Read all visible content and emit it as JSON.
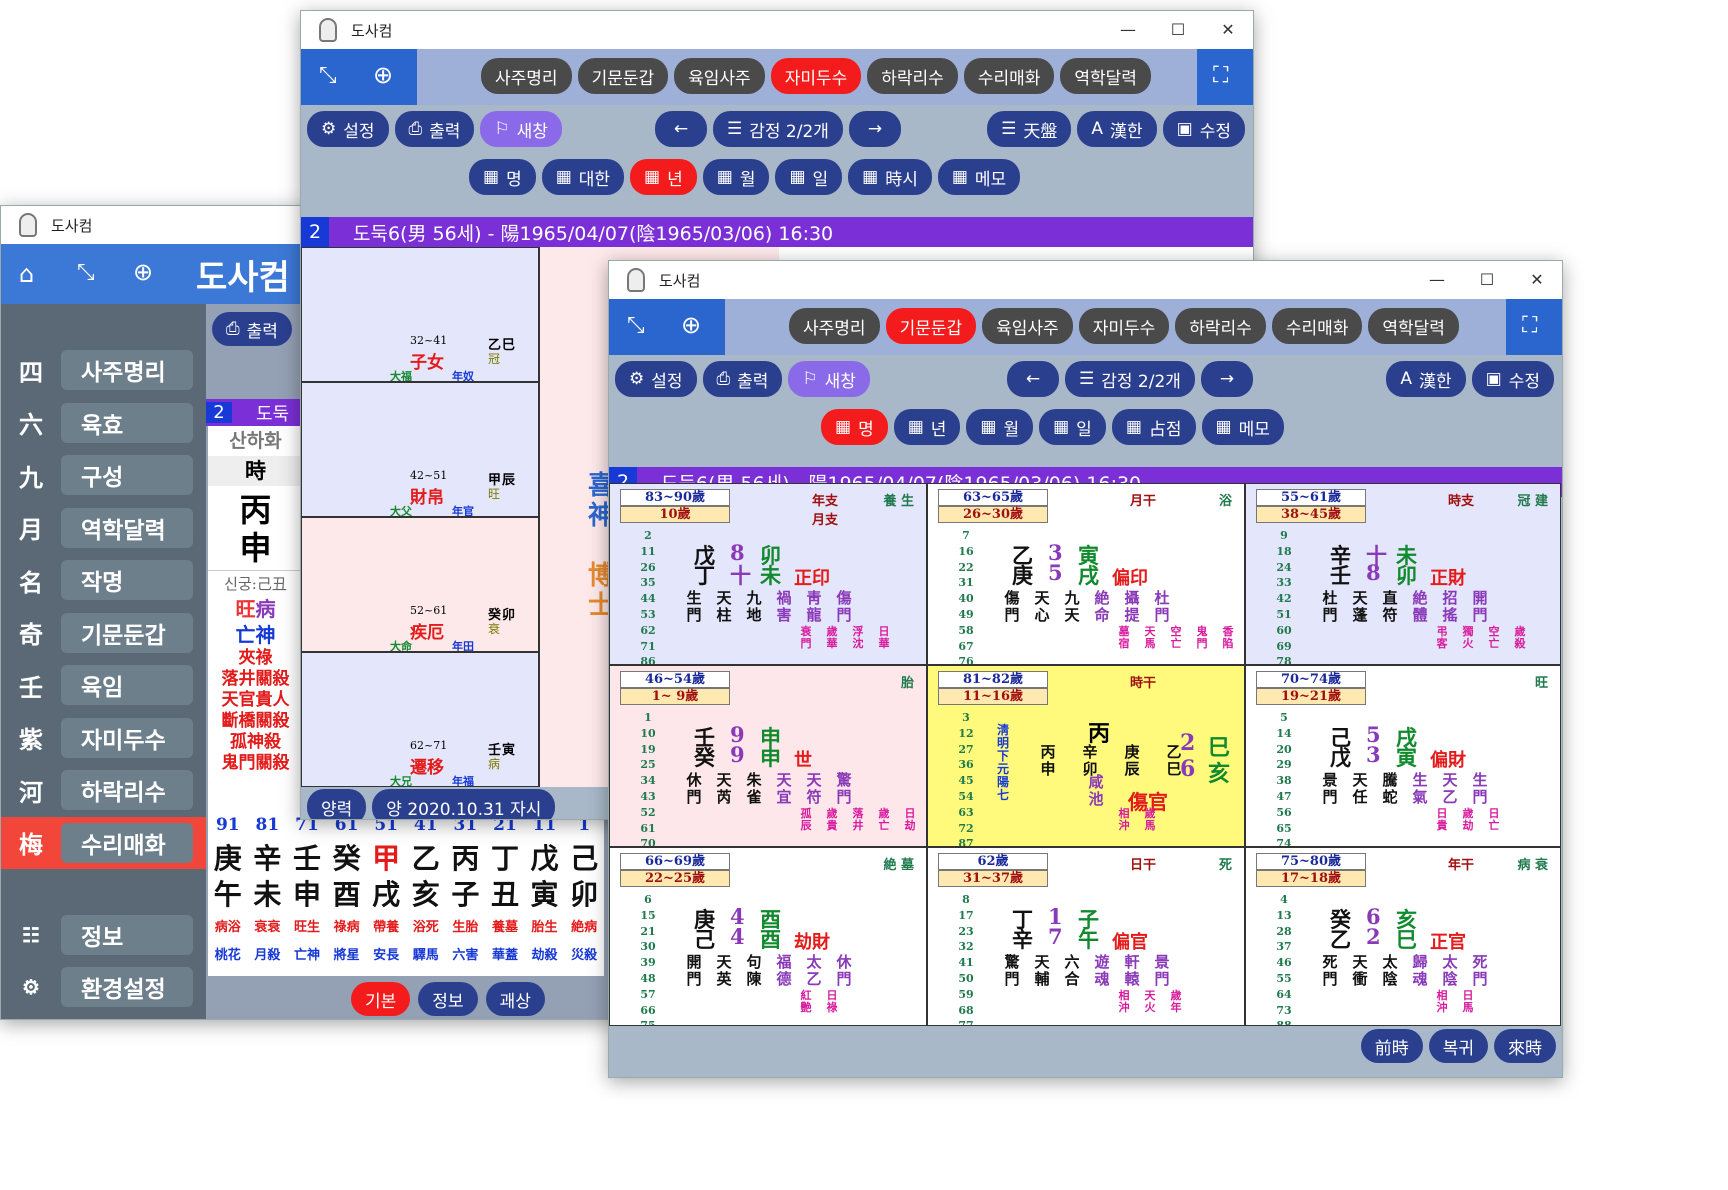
{
  "app": {
    "title": "도사컴"
  },
  "win1": {
    "title": "도사컴",
    "brand": "도사컴",
    "print": "출력",
    "chart_no": "2",
    "chart_title": "도둑",
    "sidebar": [
      {
        "c": "四",
        "t": "사주명리"
      },
      {
        "c": "六",
        "t": "육효"
      },
      {
        "c": "九",
        "t": "구성"
      },
      {
        "c": "月",
        "t": "역학달력"
      },
      {
        "c": "名",
        "t": "작명"
      },
      {
        "c": "奇",
        "t": "기문둔갑"
      },
      {
        "c": "壬",
        "t": "육임"
      },
      {
        "c": "紫",
        "t": "자미두수"
      },
      {
        "c": "河",
        "t": "하락리수"
      },
      {
        "c": "梅",
        "t": "수리매화"
      }
    ],
    "sidebar_bottom": [
      {
        "t": "정보"
      },
      {
        "t": "환경설정"
      }
    ],
    "left_col": {
      "sanhahwa": "산하화",
      "shi": "時",
      "pillar_top": "丙",
      "pillar_bottom": "申",
      "singung": "신궁:己丑",
      "wang": "旺",
      "byeong": "病",
      "mangsin": "亡神",
      "sal": [
        "夾祿",
        "落井關殺",
        "天官貴人",
        "斷橋關殺",
        "孤神殺",
        "鬼門關殺"
      ]
    },
    "daewoon": {
      "ages": [
        "91",
        "81",
        "71",
        "61",
        "51",
        "41",
        "31",
        "21",
        "11",
        "1"
      ],
      "top": [
        "庚",
        "辛",
        "壬",
        "癸",
        "甲",
        "乙",
        "丙",
        "丁",
        "戊",
        "己"
      ],
      "bottom": [
        "午",
        "未",
        "申",
        "酉",
        "戌",
        "亥",
        "子",
        "丑",
        "寅",
        "卯"
      ],
      "stage": [
        "病浴",
        "衰衰",
        "旺生",
        "祿病",
        "帶養",
        "浴死",
        "生胎",
        "養墓",
        "胎生",
        "絶病"
      ],
      "sinsal": [
        "桃花",
        "月殺",
        "亡神",
        "將星",
        "安長",
        "驛馬",
        "六害",
        "華蓋",
        "劫殺",
        "災殺"
      ]
    },
    "tabs": [
      "기본",
      "정보",
      "괘상"
    ]
  },
  "win2": {
    "title": "도사컴",
    "menu": [
      "사주명리",
      "기문둔갑",
      "육임사주",
      "자미두수",
      "하락리수",
      "수리매화",
      "역학달력"
    ],
    "active_menu": "자미두수",
    "toolbar": {
      "settings": "설정",
      "print": "출력",
      "newwin": "새창",
      "gamjeong": "감정 2/2개",
      "tianpan": "天盤",
      "hanja": "漢한",
      "edit": "수정"
    },
    "tabs": [
      "명명",
      "대한",
      "년년",
      "월월",
      "일일",
      "時시",
      "메모"
    ],
    "tab_labels": [
      "명",
      "대한",
      "년",
      "월",
      "일",
      "時시",
      "메모"
    ],
    "chart_no": "2",
    "header": "도둑6(男 56세) - 陽1965/04/07(陰1965/03/06) 16:30",
    "palaces": [
      {
        "name": "子女",
        "age": "32~41",
        "gz": "乙巳",
        "gz_top": "乙",
        "gz_bottom": "巳",
        "sub": "冠",
        "dae": "大福",
        "nyeon": "年奴"
      },
      {
        "name": "財帛",
        "age": "42~51",
        "gz": "甲辰",
        "gz_top": "甲",
        "gz_bottom": "辰",
        "sub": "旺",
        "dae": "大父",
        "nyeon": "年官"
      },
      {
        "name": "疾厄",
        "age": "52~61",
        "gz": "癸卯",
        "gz_top": "癸",
        "gz_bottom": "卯",
        "sub": "衰",
        "dae": "大命",
        "nyeon": "年田"
      },
      {
        "name": "遷移",
        "age": "62~71",
        "gz": "壬寅",
        "gz_top": "壬",
        "gz_bottom": "寅",
        "sub": "病",
        "dae": "大兄",
        "nyeon": "年福"
      }
    ],
    "center": {
      "c1": "喜",
      "c2": "神",
      "c3": "博",
      "c4": "士"
    },
    "bottom_bar": {
      "yangnyeok": "양력",
      "date": "양 2020.10.31 자시"
    }
  },
  "win3": {
    "title": "도사컴",
    "menu": [
      "사주명리",
      "기문둔갑",
      "육임사주",
      "자미두수",
      "하락리수",
      "수리매화",
      "역학달력"
    ],
    "active_menu": "기문둔갑",
    "toolbar": {
      "settings": "설정",
      "print": "출력",
      "newwin": "새창",
      "gamjeong": "감정 2/2개",
      "hanja": "漢한",
      "edit": "수정"
    },
    "tabs": [
      "명명",
      "년년",
      "월월",
      "일일",
      "점점",
      "메모"
    ],
    "tab_labels": [
      "명",
      "년",
      "월",
      "일",
      "占점",
      "메모"
    ],
    "chart_no": "2",
    "header": "도둑6(男 56세) - 陽1965/04/07(陰1965/03/06) 16:30",
    "cells": [
      {
        "a1": "83~90歲",
        "a2": "10歲",
        "nums": [
          "2",
          "11",
          "26",
          "35",
          "44",
          "53",
          "62",
          "71",
          "86"
        ],
        "g1": "戊",
        "g2": "丁",
        "n1": "8",
        "n2": "十",
        "j1": "卯",
        "j2": "未",
        "rel": "正印",
        "tr": "年支\n月支",
        "st": "養 生",
        "mid": [
          "生門",
          "天柱",
          "九地",
          "禍害",
          "靑龍",
          "傷門"
        ],
        "low": [
          "衰門",
          "歲華",
          "浮沈",
          "日華"
        ],
        "bg": "#e4e6fb"
      },
      {
        "a1": "63~65歲",
        "a2": "26~30歲",
        "nums": [
          "7",
          "16",
          "22",
          "31",
          "40",
          "49",
          "58",
          "67",
          "76",
          "82"
        ],
        "g1": "乙",
        "g2": "庚",
        "n1": "3",
        "n2": "5",
        "j1": "寅",
        "j2": "戌",
        "rel": "偏印",
        "tr": "月干",
        "st": "浴",
        "mid": [
          "傷門",
          "天心",
          "九天",
          "絶命",
          "攝提",
          "杜門"
        ],
        "low": [
          "墓宿",
          "天馬",
          "空亡",
          "鬼門",
          "香陷"
        ],
        "bg": "#ffffff"
      },
      {
        "a1": "55~61歲",
        "a2": "38~45歲",
        "nums": [
          "9",
          "18",
          "24",
          "33",
          "42",
          "51",
          "60",
          "69",
          "78",
          "84"
        ],
        "g1": "辛",
        "g2": "壬",
        "n1": "十",
        "n2": "8",
        "j1": "未",
        "j2": "卯",
        "rel": "正財",
        "tr": "時支",
        "st": "冠 建",
        "mid": [
          "杜門",
          "天蓬",
          "直符",
          "絶體",
          "招搖",
          "開門"
        ],
        "low": [
          "弔客",
          "獨火",
          "空亡",
          "歲殺"
        ],
        "bg": "#e4e6fb"
      },
      {
        "a1": "46~54歲",
        "a2": "1~ 9歲",
        "nums": [
          "1",
          "10",
          "19",
          "25",
          "34",
          "43",
          "52",
          "61",
          "70",
          "79"
        ],
        "g1": "壬",
        "g2": "癸",
        "n1": "9",
        "n2": "9",
        "j1": "申",
        "j2": "申",
        "rel": "世",
        "tr": "",
        "st": "胎",
        "mid": [
          "休門",
          "天芮",
          "朱雀",
          "天宜",
          "天符",
          "驚門"
        ],
        "low": [
          "孤辰",
          "歲貴",
          "落井",
          "歲亡",
          "日劫"
        ],
        "bg": "#fde7ea"
      },
      {
        "a1": "81~82歲",
        "a2": "11~16歲",
        "nums": [
          "3",
          "12",
          "27",
          "36",
          "45",
          "54",
          "63",
          "72",
          "87"
        ],
        "g1": "丙",
        "g2": "",
        "n1": "2",
        "n2": "6",
        "j1": "巳",
        "j2": "亥",
        "rel": "傷官",
        "tr": "時干",
        "st": "",
        "mid": [
          "丙申",
          "辛卯",
          "庚辰",
          "乙巳"
        ],
        "low": [
          "相沖",
          "歲馬"
        ],
        "bg": "#fffa7c",
        "center": "咸池",
        "side": "淸明下元 陽七"
      },
      {
        "a1": "70~74歲",
        "a2": "19~21歲",
        "nums": [
          "5",
          "14",
          "20",
          "29",
          "38",
          "47",
          "56",
          "65",
          "74",
          "80"
        ],
        "g1": "己",
        "g2": "戊",
        "n1": "5",
        "n2": "3",
        "j1": "戌",
        "j2": "寅",
        "rel": "偏財",
        "tr": "",
        "st": "旺",
        "mid": [
          "景門",
          "天任",
          "騰蛇",
          "生氣",
          "天乙",
          "生門"
        ],
        "low": [
          "日貴",
          "歲劫",
          "日亡"
        ],
        "bg": "#ffffff"
      },
      {
        "a1": "66~69歲",
        "a2": "22~25歲",
        "nums": [
          "6",
          "15",
          "21",
          "30",
          "39",
          "48",
          "57",
          "66",
          "75",
          "81"
        ],
        "g1": "庚",
        "g2": "己",
        "n1": "4",
        "n2": "4",
        "j1": "酉",
        "j2": "酉",
        "rel": "劫財",
        "tr": "",
        "st": "絶 墓",
        "mid": [
          "開門",
          "天英",
          "句陳",
          "福德",
          "太乙",
          "休門"
        ],
        "low": [
          "紅艶",
          "日祿"
        ],
        "bg": "#ffffff"
      },
      {
        "a1": "62歲",
        "a2": "31~37歲",
        "nums": [
          "8",
          "17",
          "23",
          "32",
          "41",
          "50",
          "59",
          "68",
          "77",
          "83"
        ],
        "g1": "丁",
        "g2": "辛",
        "n1": "1",
        "n2": "7",
        "j1": "子",
        "j2": "午",
        "rel": "偏官",
        "tr": "日干",
        "st": "死",
        "mid": [
          "驚門",
          "天輔",
          "六合",
          "遊魂",
          "軒轅",
          "景門"
        ],
        "low": [
          "相沖",
          "天火",
          "歲年"
        ],
        "bg": "#ffffff"
      },
      {
        "a1": "75~80歲",
        "a2": "17~18歲",
        "nums": [
          "4",
          "13",
          "28",
          "37",
          "46",
          "55",
          "64",
          "73",
          "88"
        ],
        "g1": "癸",
        "g2": "乙",
        "n1": "6",
        "n2": "2",
        "j1": "亥",
        "j2": "巳",
        "rel": "正官",
        "tr": "年干",
        "st": "病 衰",
        "mid": [
          "死門",
          "天衝",
          "太陰",
          "歸魂",
          "太陰",
          "死門"
        ],
        "low": [
          "相沖",
          "日馬"
        ],
        "bg": "#ffffff"
      }
    ],
    "footer": [
      "前時",
      "복귀",
      "來時"
    ]
  }
}
